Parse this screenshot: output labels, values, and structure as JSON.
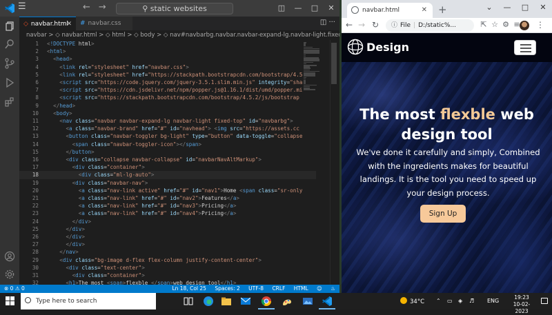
{
  "vscode": {
    "menu_icon": "hamburger-icon",
    "search_text": "static websites",
    "tabs": [
      {
        "label": "navbar.html",
        "icon": "html-file-icon",
        "active": true
      },
      {
        "label": "navbar.css",
        "icon": "css-file-icon",
        "active": false
      }
    ],
    "breadcrumb": "navbar > ◇ navbar.html > ◇ html > ◇ body > ◇ nav#navbarbg.navbar.navbar-expand-lg.navbar-light.fixed-top > ◇ div#navbarNav",
    "lines": [
      {
        "n": "1",
        "t": "<!DOCTYPE html>"
      },
      {
        "n": "2",
        "t": "<html>"
      },
      {
        "n": "3",
        "t": "  <head>"
      },
      {
        "n": "4",
        "t": "    <link rel=\"stylesheet\" href=\"navbar.css\">"
      },
      {
        "n": "5",
        "t": "    <link rel=\"stylesheet\" href=\"https://stackpath.bootstrapcdn.com/bootstrap/4.5"
      },
      {
        "n": "6",
        "t": "    <script src=\"https://code.jquery.com/jquery-3.5.1.slim.min.js\" integrity=\"sha"
      },
      {
        "n": "7",
        "t": "    <script src=\"https://cdn.jsdelivr.net/npm/popper.js@1.16.1/dist/umd/popper.mi"
      },
      {
        "n": "8",
        "t": "    <script src=\"https://stackpath.bootstrapcdn.com/bootstrap/4.5.2/js/bootstrap"
      },
      {
        "n": "9",
        "t": "  </head>"
      },
      {
        "n": "10",
        "t": "  <body>"
      },
      {
        "n": "11",
        "t": "    <nav class=\"navbar navbar-expand-lg navbar-light fixed-top\" id=\"navbarbg\">"
      },
      {
        "n": "12",
        "t": "      <a class=\"navbar-brand\" href=\"#\" id=\"navhead\"> <img src=\"https://assets.cc"
      },
      {
        "n": "13",
        "t": "      <button class=\"navbar-toggler bg-light\" type=\"button\" data-toggle=\"collapse"
      },
      {
        "n": "14",
        "t": "        <span class=\"navbar-toggler-icon\"></span>"
      },
      {
        "n": "15",
        "t": "      </button>"
      },
      {
        "n": "16",
        "t": "      <div class=\"collapse navbar-collapse\" id=\"navbarNavAltMarkup\">"
      },
      {
        "n": "17",
        "t": "        <div class=\"container\">"
      },
      {
        "n": "18",
        "t": "          <div class=\"ml-lg-auto\">"
      },
      {
        "n": "19",
        "t": "        <div class=\"navbar-nav\">"
      },
      {
        "n": "20",
        "t": "          <a class=\"nav-link active\" href=\"#\" id=\"nav1\">Home <span class=\"sr-only"
      },
      {
        "n": "21",
        "t": "          <a class=\"nav-link\" href=\"#\" id=\"nav2\">Features</a>"
      },
      {
        "n": "22",
        "t": "          <a class=\"nav-link\" href=\"#\" id=\"nav3\">Pricing</a>"
      },
      {
        "n": "23",
        "t": "          <a class=\"nav-link\" href=\"#\" id=\"nav4\">Pricing</a>"
      },
      {
        "n": "24",
        "t": "        </div>"
      },
      {
        "n": "25",
        "t": "      </div>"
      },
      {
        "n": "26",
        "t": "      </div>"
      },
      {
        "n": "27",
        "t": "      </div>"
      },
      {
        "n": "28",
        "t": "    </nav>"
      },
      {
        "n": "29",
        "t": "    <div class=\"bg-image d-flex flex-column justify-content-center\">"
      },
      {
        "n": "30",
        "t": "      <div class=\"text-center\">"
      },
      {
        "n": "31",
        "t": "        <div class=\"container\">"
      },
      {
        "n": "32",
        "t": "      <h1>The most <span>flexble </span>web design tool</h1>"
      }
    ],
    "status": {
      "errors": "0",
      "warnings": "0",
      "position": "Ln 18, Col 25",
      "spaces": "Spaces: 2",
      "encoding": "UTF-8",
      "eol": "CRLF",
      "language": "HTML"
    }
  },
  "chrome": {
    "tab_title": "navbar.html",
    "address_prefix": "File",
    "address": "D:/static%...",
    "page": {
      "brand": "Design",
      "hero_before": "The most ",
      "hero_highlight": "flexble",
      "hero_after": " web design tool",
      "paragraph": "We've done it carefully and simply, Combined with the ingredients makes for beautiful landings. It is the tool you need to speed up your design process.",
      "cta": "Sign Up",
      "accent_color": "#f4c996",
      "button_color": "#f7c99a"
    }
  },
  "taskbar": {
    "search_placeholder": "Type here to search",
    "weather": "34°C",
    "language": "ENG",
    "time": "19:23",
    "date": "10-02-2023"
  }
}
